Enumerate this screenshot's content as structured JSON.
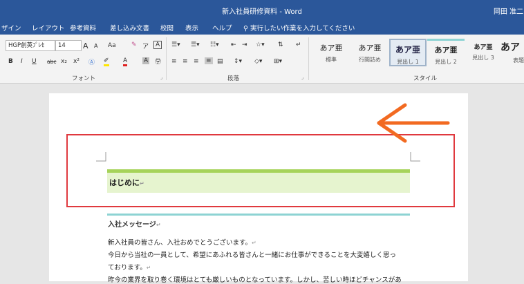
{
  "titlebar": {
    "doc_title": "新入社員研修資料 - Word",
    "user": "岡田 准二"
  },
  "menu": [
    "ザイン",
    "レイアウト",
    "参考資料",
    "差し込み文書",
    "校閲",
    "表示",
    "ヘルプ",
    "実行したい作業を入力してください"
  ],
  "font_group": {
    "font_name": "HGP創英ﾌﾟﾚｾ",
    "font_size": "14",
    "label": "フォント",
    "grow": "A",
    "shrink": "A",
    "change_case": "Aa",
    "bold": "B",
    "italic": "I",
    "underline": "U",
    "strike": "abc",
    "subscript": "x₂",
    "superscript": "x²"
  },
  "paragraph_group": {
    "label": "段落"
  },
  "styles_group": {
    "label": "スタイル",
    "items": [
      {
        "sample": "あア亜",
        "name": "標準"
      },
      {
        "sample": "あア亜",
        "name": "行間詰め"
      },
      {
        "sample": "あア亜",
        "name": "見出し 1"
      },
      {
        "sample": "あア亜",
        "name": "見出し 2"
      },
      {
        "sample": "あア亜",
        "name": "見出し 3"
      },
      {
        "sample": "あア",
        "name": "表題"
      }
    ]
  },
  "document": {
    "heading1": "はじめに",
    "heading2": "入社メッセージ",
    "paragraphs": [
      "新入社員の皆さん、入社おめでとうございます。",
      "今日から当社の一員として、希望にあふれる皆さんと一緒にお仕事ができることを大変嬉しく思っ",
      "ております。",
      "昨今の業界を取り巻く環境はとても厳しいものとなっています。しかし、苦しい時ほどチャンスがあ"
    ]
  },
  "colors": {
    "titlebar": "#2b579a",
    "heading1_border": "#a6d35a",
    "heading1_fill": "#e6f4cf",
    "heading2_border": "#8dd3d3",
    "highlight_box": "#e0393e",
    "arrow": "#f26a21"
  },
  "icons": [
    "search-icon",
    "arrow-left-icon",
    "paragraph-mark-icon"
  ]
}
